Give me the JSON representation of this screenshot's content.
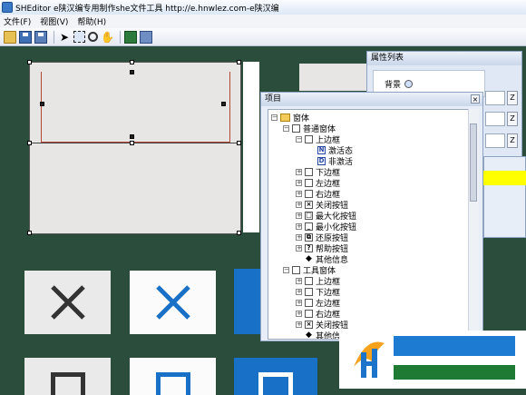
{
  "window": {
    "title": "SHEditor  e陕汉编专用制作she文件工具  http://e.hnwlez.com-e陕汉编"
  },
  "menu": [
    "文件(F)",
    "视图(V)",
    "帮助(H)"
  ],
  "properties_panel": {
    "title": "属性列表",
    "rows": [
      {
        "label": "背景"
      }
    ]
  },
  "project_panel": {
    "title": "项目",
    "tree": [
      {
        "label": "窗体"
      },
      {
        "label": "普通窗体"
      },
      {
        "label": "上边框"
      },
      {
        "label": "激活态"
      },
      {
        "label": "非激活"
      },
      {
        "label": "下边框"
      },
      {
        "label": "左边框"
      },
      {
        "label": "右边框"
      },
      {
        "label": "关闭按钮"
      },
      {
        "label": "最大化按钮"
      },
      {
        "label": "最小化按钮"
      },
      {
        "label": "还原按钮"
      },
      {
        "label": "帮助按钮"
      },
      {
        "label": "其他信息"
      },
      {
        "label": "工具窗体"
      },
      {
        "label": "上边框"
      },
      {
        "label": "下边框"
      },
      {
        "label": "左边框"
      },
      {
        "label": "右边框"
      },
      {
        "label": "关闭按钮"
      },
      {
        "label": "其他信..."
      }
    ]
  },
  "colors": {
    "canvas_bg": "#2a4e3b",
    "accent_blue": "#1971c7",
    "highlight_yellow": "#ffff00"
  }
}
